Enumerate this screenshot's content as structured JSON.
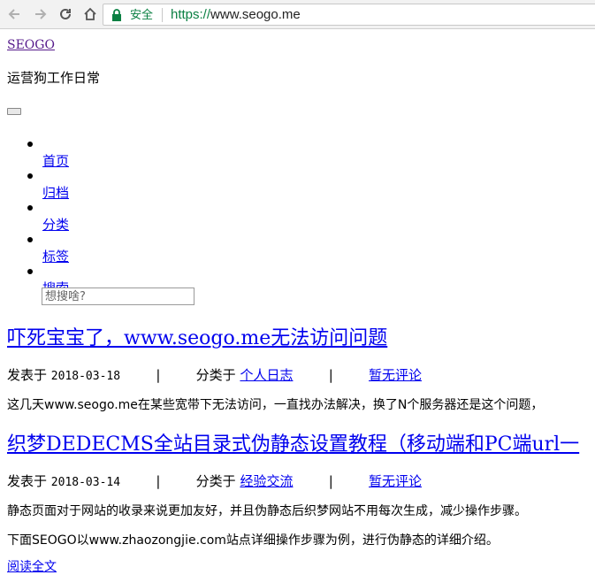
{
  "browser": {
    "secure_label": "安全",
    "url_scheme": "https://",
    "url_host": "www.seogo.me"
  },
  "site": {
    "title": "SEOGO",
    "description": "运营狗工作日常"
  },
  "nav": {
    "items": [
      {
        "label": "首页"
      },
      {
        "label": "归档"
      },
      {
        "label": "分类"
      },
      {
        "label": "标签"
      },
      {
        "label": "搜索"
      }
    ],
    "search_placeholder": "想搜啥?"
  },
  "posts": [
    {
      "title": "吓死宝宝了，www.seogo.me无法访问问题",
      "published_label": "发表于",
      "date": "2018-03-18",
      "category_label": "分类于",
      "category": "个人日志",
      "comments": "暂无评论",
      "excerpt": [
        "这几天www.seogo.me在某些宽带下无法访问，一直找办法解决，换了N个服务器还是这个问题，"
      ]
    },
    {
      "title": "织梦DEDECMS全站目录式伪静态设置教程（移动端和PC端url一",
      "published_label": "发表于",
      "date": "2018-03-14",
      "category_label": "分类于",
      "category": "经验交流",
      "comments": "暂无评论",
      "excerpt": [
        "静态页面对于网站的收录来说更加友好，并且伪静态后织梦网站不用每次生成，减少操作步骤。",
        "下面SEOGO以www.zhaozongjie.com站点详细操作步骤为例，进行伪静态的详细介绍。"
      ]
    }
  ],
  "partial_link": "阅读全文"
}
